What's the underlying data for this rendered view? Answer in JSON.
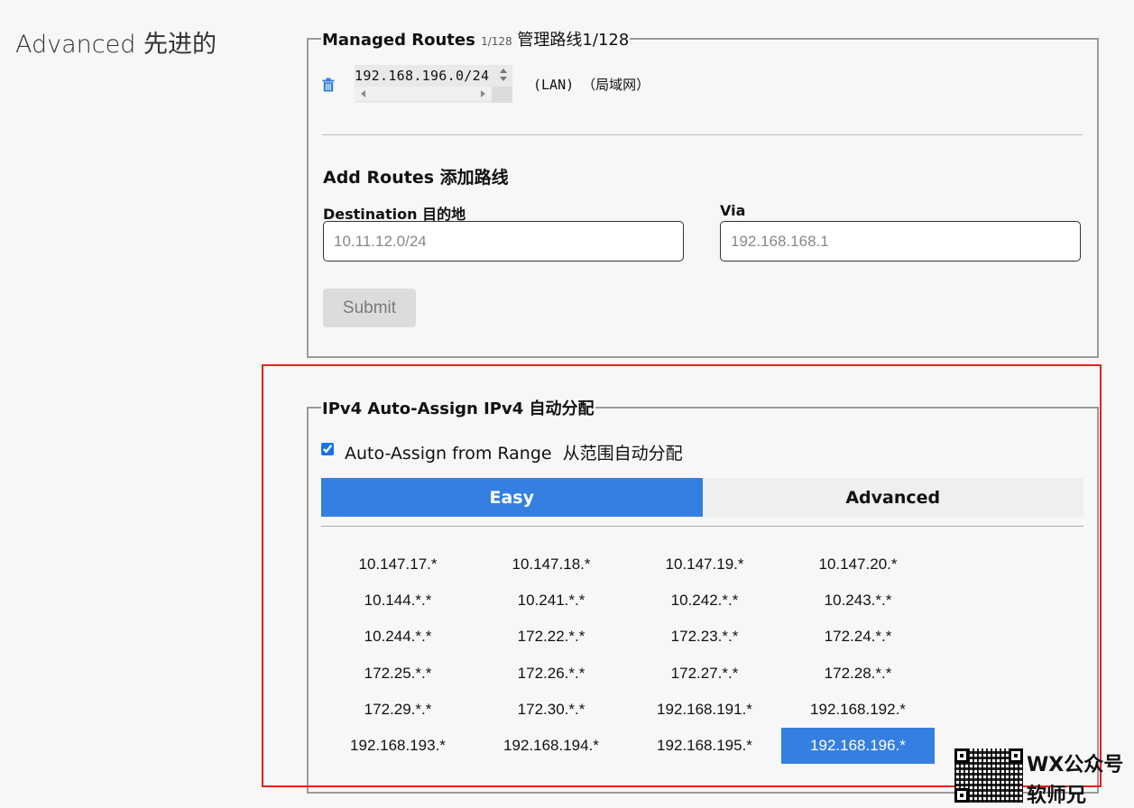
{
  "page": {
    "title": "Advanced 先进的"
  },
  "managed_routes": {
    "legend_title": "Managed Routes ",
    "legend_count": "1/128",
    "legend_cn": " 管理路线1/128",
    "routes": [
      {
        "target": "192.168.196.0/24",
        "via_label": "(LAN) （局域网）"
      }
    ]
  },
  "add_routes": {
    "title": "Add Routes 添加路线",
    "destination_label": "Destination 目的地",
    "destination_placeholder": "10.11.12.0/24",
    "destination_value": "",
    "via_label": "Via",
    "via_placeholder": "192.168.168.1",
    "via_value": "",
    "submit_label": "Submit"
  },
  "auto_assign": {
    "legend": "IPv4 Auto-Assign IPv4 自动分配",
    "checkbox_label": "Auto-Assign from Range  从范围自动分配",
    "checked": true,
    "tabs": [
      {
        "label": "Easy",
        "active": true
      },
      {
        "label": "Advanced",
        "active": false
      }
    ],
    "ranges": [
      "10.147.17.*",
      "10.147.18.*",
      "10.147.19.*",
      "10.147.20.*",
      "10.144.*.*",
      "10.241.*.*",
      "10.242.*.*",
      "10.243.*.*",
      "10.244.*.*",
      "172.22.*.*",
      "172.23.*.*",
      "172.24.*.*",
      "172.25.*.*",
      "172.26.*.*",
      "172.27.*.*",
      "172.28.*.*",
      "172.29.*.*",
      "172.30.*.*",
      "192.168.191.*",
      "192.168.192.*",
      "192.168.193.*",
      "192.168.194.*",
      "192.168.195.*",
      "192.168.196.*"
    ],
    "selected_range": "192.168.196.*"
  },
  "colors": {
    "accent": "#347fe0",
    "highlight_border": "#e8201c",
    "trash_icon": "#2f7fd6"
  },
  "watermark": {
    "line1": "WX公众号",
    "line2": "软师兄"
  }
}
